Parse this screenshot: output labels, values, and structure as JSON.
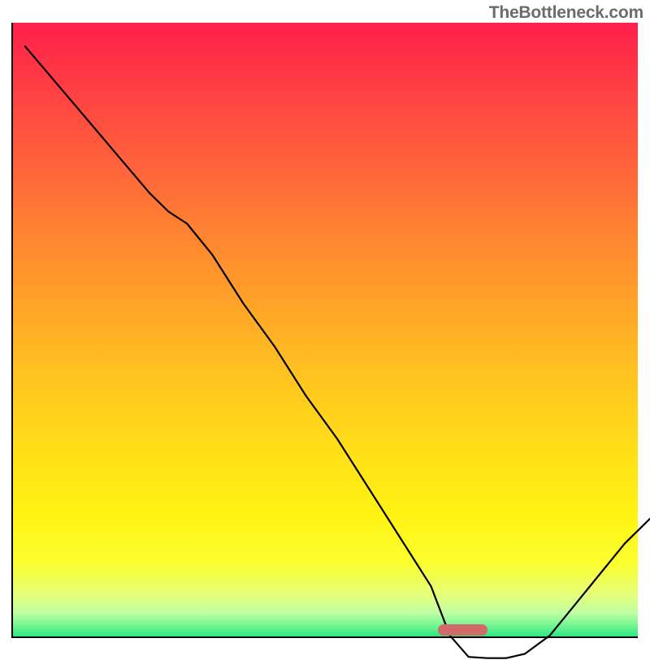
{
  "watermark": "TheBottleneck.com",
  "chart_data": {
    "type": "line",
    "title": "",
    "xlabel": "",
    "ylabel": "",
    "xlim": [
      0,
      100
    ],
    "ylim": [
      0,
      100
    ],
    "legend": false,
    "grid": false,
    "annotations": [],
    "background_gradient": {
      "orientation": "vertical",
      "top_color": "#ff1f4c",
      "mid_color": "#ffe018",
      "bottom_color": "#29e481"
    },
    "marker": {
      "x_start": 68,
      "x_end": 76,
      "y": 0.7,
      "color": "#d36a6a"
    },
    "series": [
      {
        "name": "bottleneck-curve",
        "x": [
          0,
          5,
          10,
          15,
          20,
          23,
          26,
          30,
          35,
          40,
          45,
          50,
          55,
          60,
          65,
          68,
          71,
          74,
          77,
          80,
          84,
          88,
          92,
          96,
          100
        ],
        "y": [
          100,
          94,
          88,
          82,
          76,
          73,
          71,
          66,
          58,
          51,
          43,
          36,
          28,
          20,
          12,
          4,
          0.5,
          0.3,
          0.3,
          1,
          4,
          9,
          14,
          19,
          23
        ]
      }
    ]
  }
}
